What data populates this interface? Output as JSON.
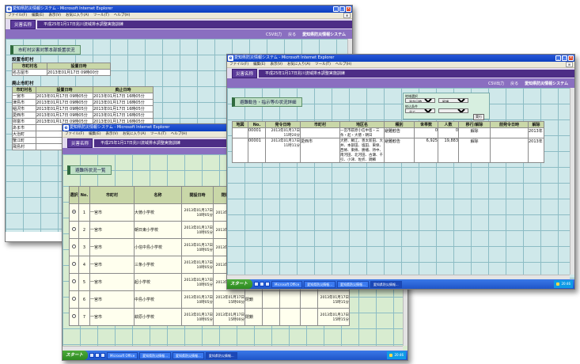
{
  "browser": {
    "title": "愛知県防災情報システム - Microsoft Internet Explorer",
    "menu": [
      "ファイル(F)",
      "編集(E)",
      "表示(V)",
      "お気に入り(A)",
      "ツール(T)",
      "ヘルプ(H)"
    ]
  },
  "app": {
    "badge": "災害名称",
    "disaster": "平成25年1月17日兆川流域排水調整実施訓練",
    "csv_link": "CSV出力",
    "back_link": "戻る",
    "system_name": "愛知県防災情報システム"
  },
  "win1": {
    "section_title": "市町村災害対策本部設置状況",
    "set_title": "設置市町村",
    "set_headers": [
      "市町村名",
      "設置日時"
    ],
    "set_rows": [
      [
        "名古屋市",
        "2013年01月17日 09時00分"
      ]
    ],
    "abolished_title": "廃止市町村",
    "abolished_headers": [
      "市町村名",
      "設置日時",
      "廃止日時"
    ],
    "abolished_rows": [
      [
        "一宮市",
        "2013年01月17日 09時05分",
        "2013年01月17日 16時05分"
      ],
      [
        "津島市",
        "2013年01月17日 09時05分",
        "2013年01月17日 16時05分"
      ],
      [
        "稲沢市",
        "2013年01月17日 09時05分",
        "2013年01月17日 16時05分"
      ],
      [
        "愛西市",
        "2013年01月17日 09時05分",
        "2013年01月17日 16時05分"
      ],
      [
        "弥富市",
        "2013年01月17日 09時05分",
        "2013年01月17日 16時05分"
      ],
      [
        "あま市",
        "",
        ""
      ],
      [
        "大治町",
        "",
        ""
      ],
      [
        "蟹江町",
        "",
        ""
      ],
      [
        "飛島村",
        "",
        ""
      ]
    ]
  },
  "win2": {
    "section_title": "避難所状況一覧",
    "headers": [
      "選択",
      "No.",
      "市町村",
      "名称",
      "開設日時",
      "閉鎖日時"
    ],
    "rows": [
      {
        "no": "1",
        "city": "一宮市",
        "name": "大徳小学校",
        "opened": "2013年01月17日 10時05分",
        "closed": "2013年01月17日",
        "status": "",
        "extra": ""
      },
      {
        "no": "2",
        "city": "一宮市",
        "name": "朝日東小学校",
        "opened": "2013年01月17日 10時05分",
        "closed": "2013年01月17日",
        "status": "",
        "extra": ""
      },
      {
        "no": "3",
        "city": "一宮市",
        "name": "小信中島小学校",
        "opened": "2013年01月17日 10時05分",
        "closed": "2013年01月17日",
        "status": "",
        "extra": ""
      },
      {
        "no": "4",
        "city": "一宮市",
        "name": "三条小学校",
        "opened": "2013年01月17日 10時05分",
        "closed": "2013年01月17日",
        "status": "",
        "extra": ""
      },
      {
        "no": "5",
        "city": "一宮市",
        "name": "起小学校",
        "opened": "2013年01月17日 10時05分",
        "closed": "2013年01月17日",
        "status": "",
        "extra": ""
      },
      {
        "no": "6",
        "city": "一宮市",
        "name": "中島小学校",
        "opened": "2013年01月17日 10時05分",
        "closed": "2013年01月17日 15時00分",
        "status": "閉鎖",
        "extra": "2013年01月17日 15時15分"
      },
      {
        "no": "7",
        "city": "一宮市",
        "name": "萩原小学校",
        "opened": "2013年01月17日 10時05分",
        "closed": "2013年01月17日 15時00分",
        "status": "閉鎖",
        "extra": "2013年01月17日 15時15分"
      }
    ]
  },
  "win3": {
    "section_title": "避難勧告・指示等の状況詳細",
    "filter_label_1": "地域選択",
    "filter_value_1": "発令日時",
    "filter_value_2": "昇順",
    "filter_label_2": "絞込条件",
    "filter_value_3": "全て",
    "filter_button": "実行",
    "headers": [
      "地図",
      "No.",
      "発令日時",
      "市町村",
      "地区名",
      "種別",
      "世帯数",
      "人数",
      "移行/解除",
      "前発令日時",
      "解除"
    ],
    "rows": [
      {
        "no": "00001",
        "issued": "2013年01月17日 11時20分",
        "city": "",
        "area": "一宮市萩原小信中島・三条・起・大徳・朝日",
        "type": "避難勧告",
        "households": "0",
        "people": "0",
        "status": "解除",
        "prev": "",
        "release": "2013年"
      },
      {
        "no": "00001",
        "issued": "2013年01月17日 11時11分",
        "city": "愛西市",
        "area": "大野、鯛江、善太新田、大井、本部田、塩田、東保、西條、東條、勝幡、持中、南河田、北河田、古瀬、千引、小津、佐折、錦鱗",
        "type": "避難勧告",
        "households": "6,925",
        "people": "19,883",
        "status": "解除",
        "prev": "",
        "release": "2013年"
      }
    ]
  },
  "taskbar": {
    "start": "スタート",
    "tasks": [
      "Microsoft Office",
      "愛知県防災情報...",
      "愛知県防災情報...",
      "愛知県防災情報..."
    ],
    "tray": "20:46"
  }
}
